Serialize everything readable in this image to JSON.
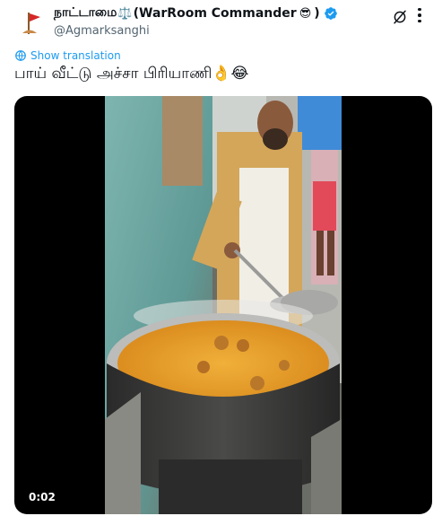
{
  "header": {
    "display_name": "நாட்டாமை",
    "display_name_suffix": "(WarRoom Commander",
    "display_name_end": ")",
    "scale_emoji": "⚖️",
    "sunglasses_emoji": "😎",
    "handle": "@Agmarksanghi"
  },
  "translate": {
    "label": "Show translation"
  },
  "tweet": {
    "text": "பாய் வீட்டு அச்சா பிரியாணி👌😂"
  },
  "media": {
    "timestamp": "0:02"
  },
  "colors": {
    "accent": "#1d9bf0",
    "text": "#0f1419",
    "muted": "#536471"
  }
}
